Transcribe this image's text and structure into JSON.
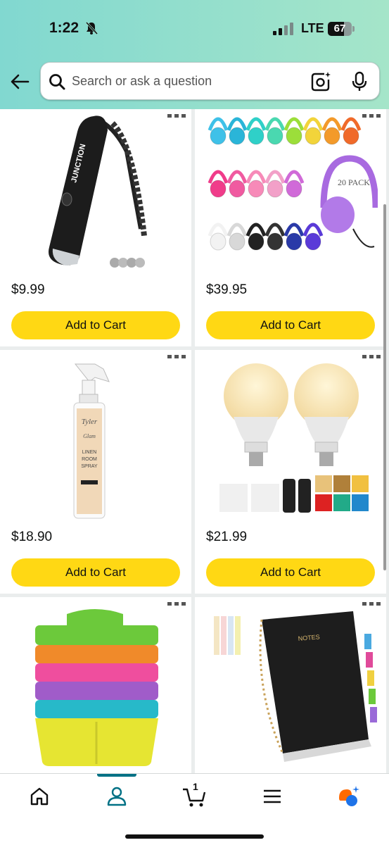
{
  "status_bar": {
    "time": "1:22",
    "network": "LTE",
    "battery": "67",
    "battery_level": 0.67
  },
  "search": {
    "placeholder": "Search or ask a question"
  },
  "products": [
    {
      "price": "$9.99",
      "button": "Add to Cart",
      "image": "whistle-image"
    },
    {
      "price": "$39.95",
      "button": "Add to Cart",
      "image": "headphones-image"
    },
    {
      "price": "$18.90",
      "button": "Add to Cart",
      "image": "linen-spray-image"
    },
    {
      "price": "$21.99",
      "button": "Add to Cart",
      "image": "light-bulbs-image"
    },
    {
      "price": "",
      "button": "",
      "image": "caddy-image"
    },
    {
      "price": "",
      "button": "",
      "image": "notebook-image"
    }
  ],
  "whistle_brand": "JUNCTION",
  "headphones_pack": "20 PACK",
  "spray_label": [
    "Tyler",
    "Glam",
    "LINEN",
    "ROOM",
    "SPRAY"
  ],
  "notebook_cover": "NOTES",
  "nav": {
    "cart_count": "1",
    "active": "account"
  },
  "colors": {
    "accent": "#ffd814",
    "header_start": "#81d8d0",
    "header_end": "#a5e5c9",
    "nav_active": "#007185"
  }
}
